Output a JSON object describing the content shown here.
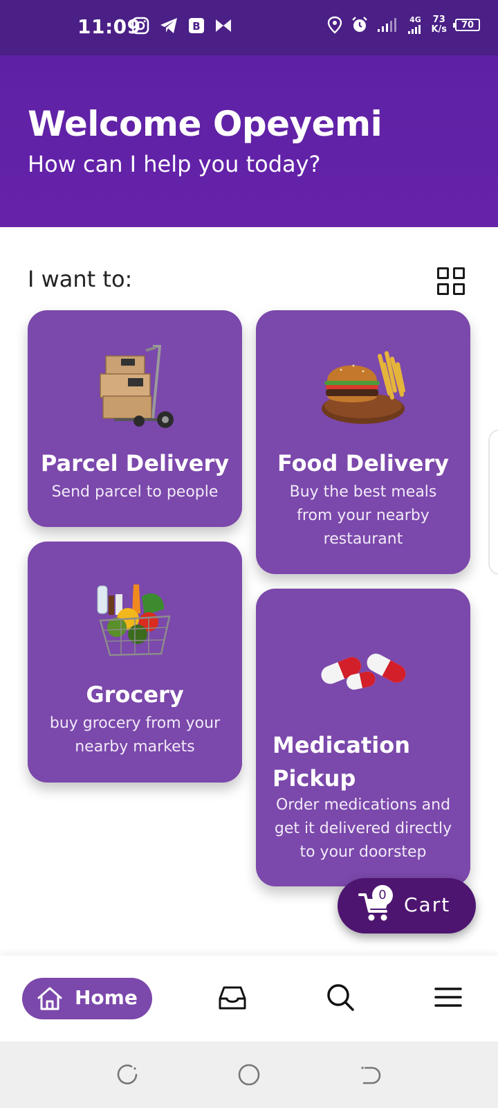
{
  "status_bar": {
    "time": "11:09",
    "net_speed_value": "73",
    "net_speed_unit": "K/s",
    "signal_label": "4G",
    "battery": "70"
  },
  "header": {
    "welcome": "Welcome Opeyemi",
    "subtitle": "How can I help you today?"
  },
  "section": {
    "heading": "I want to:"
  },
  "cards": [
    {
      "title": "Parcel Delivery",
      "description": "Send parcel to people",
      "icon": "parcel-trolley-image"
    },
    {
      "title": "Food Delivery",
      "description": "Buy the best meals from your nearby restaurant",
      "icon": "burger-fries-image"
    },
    {
      "title": "Grocery",
      "description": "buy grocery from your nearby markets",
      "icon": "grocery-basket-image"
    },
    {
      "title": "Medication Pickup",
      "description": "Order medications and get it delivered directly to your doorstep",
      "icon": "pills-image"
    }
  ],
  "cart": {
    "count": "0",
    "label": "Cart"
  },
  "bottom_nav": {
    "home_label": "Home",
    "items": [
      "home",
      "inbox",
      "search",
      "menu"
    ]
  },
  "colors": {
    "header": "#6523a9",
    "status_bar": "#4a1f86",
    "card": "#7b48ab",
    "cart": "#4d1570"
  }
}
